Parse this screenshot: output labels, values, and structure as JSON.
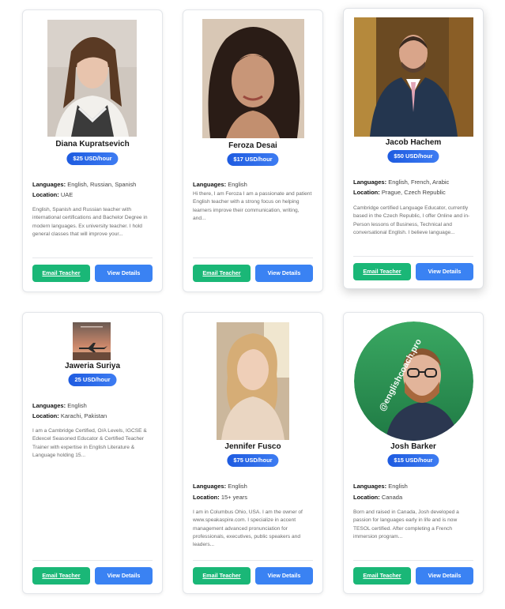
{
  "teachers": [
    {
      "name": "Diana Kupratsevich",
      "price": "$25 USD/hour",
      "languages_label": "Languages:",
      "languages": "English, Russian, Spanish",
      "location_label": "Location:",
      "location": "UAE",
      "bio": "English, Spanish and Russian teacher with international certifications and Bachelor Degree in modern languages. Ex university teacher. I hold general classes that will improve your...",
      "email_label": "Email Teacher",
      "view_label": "View Details"
    },
    {
      "name": "Feroza Desai",
      "price": "$17 USD/hour",
      "languages_label": "Languages:",
      "languages": "English",
      "location_label": "",
      "location": "",
      "bio": "Hi there, I am Feroza I am a passionate and patient English teacher with a strong focus on helping learners improve their communication, writing, and...",
      "email_label": "Email Teacher",
      "view_label": "View Details"
    },
    {
      "name": "Jacob Hachem",
      "price": "$50 USD/hour",
      "languages_label": "Languages:",
      "languages": "English, French, Arabic",
      "location_label": "Location:",
      "location": "Prague, Czech Republic",
      "bio": "Cambridge certified Language Educator, currently based in the Czech Republic, I offer Online and in-Person lessons of Business, Technical and conversational English. I believe language...",
      "email_label": "Email Teacher",
      "view_label": "View Details"
    },
    {
      "name": "Jaweria Suriya",
      "price": "25 USD/hour",
      "languages_label": "Languages:",
      "languages": "English",
      "location_label": "Location:",
      "location": "Karachi, Pakistan",
      "bio": "I am a Cambridge Certified, O/A Levels, IGCSE & Edexcel Seasoned Educator & Certified Teacher Trainer with expertise in English Literature & Language holding 15...",
      "email_label": "Email Teacher",
      "view_label": "View Details"
    },
    {
      "name": "Jennifer Fusco",
      "price": "$75 USD/hour",
      "languages_label": "Languages:",
      "languages": "English",
      "location_label": "Location:",
      "location": "15+ years",
      "bio": "I am in Columbus Ohio, USA. I am the owner of www.speakaspire.com. I specialize in accent management advanced pronunciation for professionals, executives, public speakers and leaders...",
      "email_label": "Email Teacher",
      "view_label": "View Details"
    },
    {
      "name": "Josh Barker",
      "price": "$15 USD/hour",
      "languages_label": "Languages:",
      "languages": "English",
      "location_label": "Location:",
      "location": "Canada",
      "bio": "Born and raised in Canada, Josh developed a passion for languages early in life and is now TESOL certified. After completing a French immersion program...",
      "email_label": "Email Teacher",
      "view_label": "View Details"
    }
  ],
  "logo_text": "@englishcoach.pro",
  "colors": {
    "price_badge": "#2563eb",
    "email_button": "#1ab777",
    "view_button": "#3a82f3"
  }
}
